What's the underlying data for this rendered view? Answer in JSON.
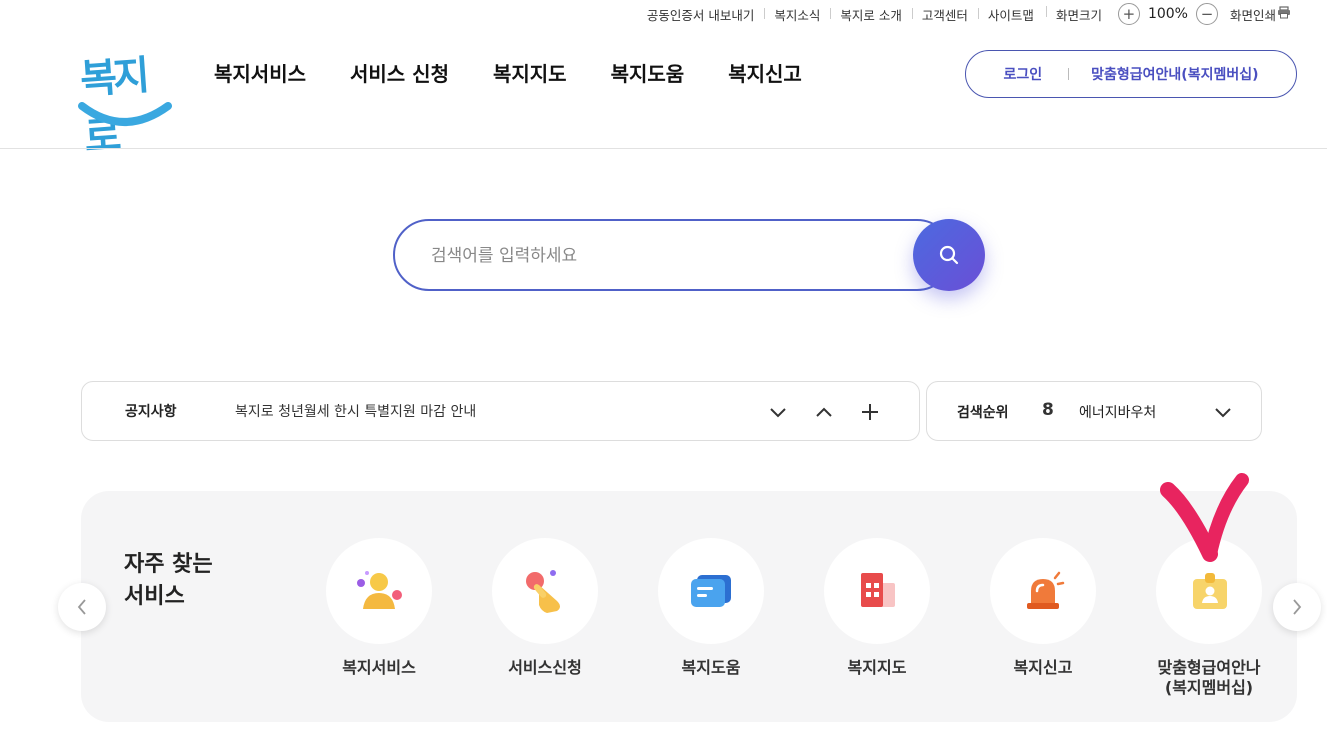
{
  "util": {
    "links": [
      "공동인증서 내보내기",
      "복지소식",
      "복지로 소개",
      "고객센터",
      "사이트맵"
    ],
    "zoom_label": "화면크기",
    "zoom_value": "100%",
    "zoom_in": "+",
    "zoom_out": "−",
    "print_label": "화면인쇄",
    "print_icon": "printer-icon"
  },
  "header": {
    "logo_text": "복지로",
    "nav": [
      "복지서비스",
      "서비스 신청",
      "복지지도",
      "복지도움",
      "복지신고"
    ],
    "login_label": "로그인",
    "membership_label": "맞춤형급여안내(복지멤버십)"
  },
  "search": {
    "placeholder": "검색어를 입력하세요",
    "value": "",
    "icon": "search-icon"
  },
  "notice": {
    "label": "공지사항",
    "text": "복지로 청년월세 한시 특별지원 마감 안내",
    "controls": [
      "chevron-down-icon",
      "chevron-up-icon",
      "plus-icon"
    ]
  },
  "ranking": {
    "label": "검색순위",
    "rank": "8",
    "keyword": "에너지바우처"
  },
  "favorites": {
    "title_line1": "자주 찾는",
    "title_line2": "서비스",
    "items": [
      {
        "label": "복지서비스",
        "icon": "person-icon"
      },
      {
        "label": "서비스신청",
        "icon": "hand-pointer-icon"
      },
      {
        "label": "복지도움",
        "icon": "chat-bubble-icon"
      },
      {
        "label": "복지지도",
        "icon": "building-map-icon"
      },
      {
        "label": "복지신고",
        "icon": "siren-icon"
      },
      {
        "label": "맞춤형급여안나\n(복지멤버십)",
        "label_line1": "맞춤형급여안나",
        "label_line2": "(복지멤버십)",
        "icon": "id-badge-icon"
      }
    ]
  },
  "colors": {
    "accent": "#5061c8",
    "logo_blue": "#2f9fd8",
    "panel_bg": "#f5f5f6",
    "checkmark": "#e8245f"
  }
}
